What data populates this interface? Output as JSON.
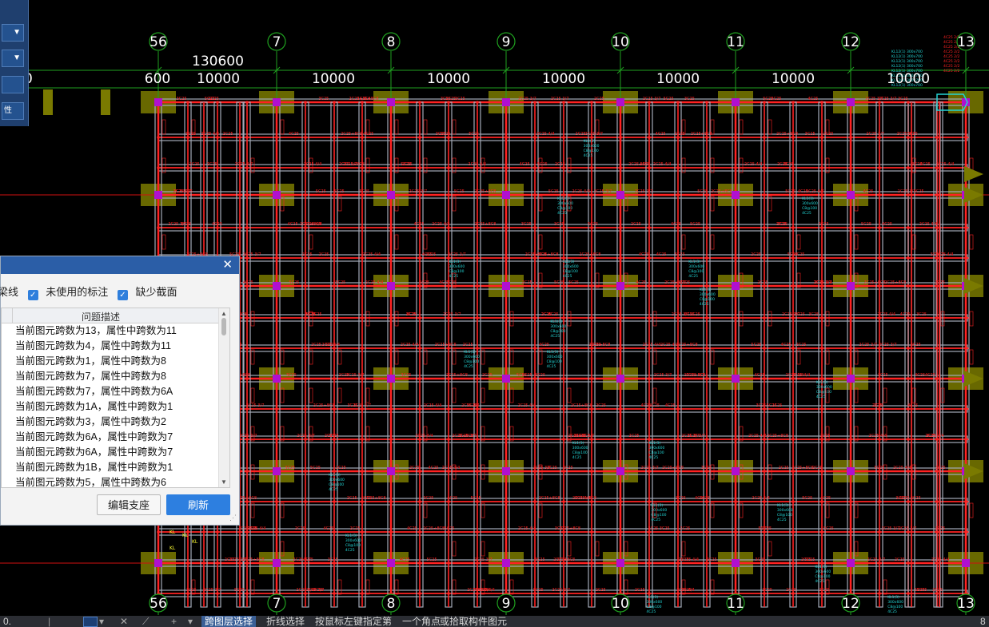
{
  "canvas": {
    "axes": [
      {
        "label": "56"
      },
      {
        "label": "7"
      },
      {
        "label": "8"
      },
      {
        "label": "9"
      },
      {
        "label": "10"
      },
      {
        "label": "11"
      },
      {
        "label": "12"
      },
      {
        "label": "13"
      }
    ],
    "total_dimension": "130600",
    "span_dimensions": [
      "600",
      "10000",
      "10000",
      "10000",
      "10000",
      "10000",
      "10000",
      "10000"
    ],
    "left_dimension_fragment": "0",
    "colors": {
      "background": "#000000",
      "beam_red": "#ff2222",
      "beam_outline": "#a4aab8",
      "axis_green": "#1fa01f",
      "dimension_text": "#ffffff",
      "column_magenta": "#b010d0",
      "support_olive": "#7a7a00",
      "annotation_cyan": "#22d4d4"
    }
  },
  "left_toolbar": {
    "items": [
      {
        "icon": "dropdown-arrow-icon"
      },
      {
        "icon": "dropdown-arrow-icon"
      },
      {
        "icon": "blank"
      },
      {
        "label": "性"
      }
    ]
  },
  "dialog": {
    "close_icon": "close-icon",
    "filters": [
      {
        "label": "梁线",
        "checked": false
      },
      {
        "label": "未使用的标注",
        "checked": true
      },
      {
        "label": "缺少截面",
        "checked": true
      }
    ],
    "table": {
      "header": "问题描述",
      "rows": [
        "当前图元跨数为13，属性中跨数为11",
        "当前图元跨数为4，属性中跨数为11",
        "当前图元跨数为1，属性中跨数为8",
        "当前图元跨数为7，属性中跨数为8",
        "当前图元跨数为7，属性中跨数为6A",
        "当前图元跨数为1A，属性中跨数为1",
        "当前图元跨数为3，属性中跨数为2",
        "当前图元跨数为6A，属性中跨数为7",
        "当前图元跨数为6A，属性中跨数为7",
        "当前图元跨数为1B，属性中跨数为1",
        "当前图元跨数为5，属性中跨数为6"
      ]
    },
    "buttons": {
      "edit_support": "编辑支座",
      "refresh": "刷新"
    }
  },
  "statusbar": {
    "items": [
      "跨图层选择",
      "折线选择",
      "按鼠标左键指定第",
      "一个角点",
      "或拾取构件图元"
    ],
    "left_fragment": "0.",
    "right_fragment": "8"
  }
}
